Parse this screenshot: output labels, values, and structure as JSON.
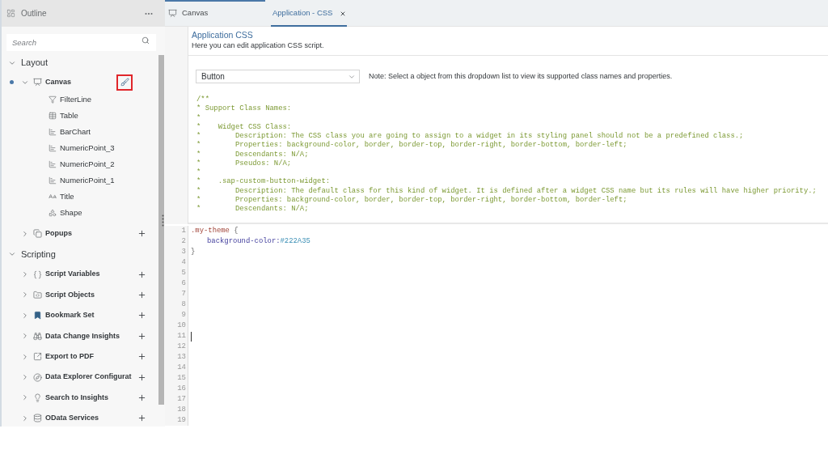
{
  "outline": {
    "title": "Outline",
    "search": {
      "placeholder": "Search"
    },
    "sections": [
      {
        "label": "Layout",
        "expanded": true,
        "children": [
          {
            "label": "Canvas",
            "kind": "canvas",
            "expanded": true,
            "active": true,
            "action": {
              "kind": "style",
              "annotated": true
            },
            "children": [
              {
                "label": "FilterLine",
                "kind": "filter"
              },
              {
                "label": "Table",
                "kind": "table"
              },
              {
                "label": "BarChart",
                "kind": "chart"
              },
              {
                "label": "NumericPoint_3",
                "kind": "chart"
              },
              {
                "label": "NumericPoint_2",
                "kind": "chart"
              },
              {
                "label": "NumericPoint_1",
                "kind": "chart"
              },
              {
                "label": "Title",
                "kind": "text"
              },
              {
                "label": "Shape",
                "kind": "shape"
              }
            ]
          },
          {
            "label": "Popups",
            "kind": "popup",
            "expanded": false,
            "active": false,
            "action": {
              "kind": "add",
              "annotated": false
            }
          }
        ]
      },
      {
        "label": "Scripting",
        "expanded": true,
        "children": [
          {
            "label": "Script Variables",
            "kind": "variable",
            "expanded": false,
            "action": {
              "kind": "add"
            }
          },
          {
            "label": "Script Objects",
            "kind": "object",
            "expanded": false,
            "action": {
              "kind": "add"
            }
          },
          {
            "label": "Bookmark Set",
            "kind": "bookmark",
            "expanded": false,
            "action": {
              "kind": "add"
            }
          },
          {
            "label": "Data Change Insights",
            "kind": "insight",
            "expanded": false,
            "action": {
              "kind": "add"
            }
          },
          {
            "label": "Export to PDF",
            "kind": "export",
            "expanded": false,
            "action": {
              "kind": "add"
            }
          },
          {
            "label": "Data Explorer Configurat",
            "kind": "explorer",
            "expanded": false,
            "action": {
              "kind": "add"
            }
          },
          {
            "label": "Search to Insights",
            "kind": "search",
            "expanded": false,
            "action": {
              "kind": "add"
            }
          },
          {
            "label": "OData Services",
            "kind": "odata",
            "expanded": false,
            "action": {
              "kind": "add"
            }
          }
        ]
      }
    ]
  },
  "tabs": [
    {
      "label": "Canvas",
      "kind": "canvas",
      "selected": false
    },
    {
      "label": "Application - CSS",
      "kind": "script",
      "selected": true
    }
  ],
  "editor": {
    "title": "Application CSS",
    "description": "Here you can edit application CSS script.",
    "dropdown": {
      "value": "Button"
    },
    "note": "Note: Select a object from this dropdown list to view its supported class names and properties.",
    "comment_lines": [
      "/**",
      "* Support Class Names:",
      "*",
      "*    Widget CSS Class:",
      "*        Description: The CSS class you are going to assign to a widget in its styling panel should not be a predefined class.;",
      "*        Properties: background-color, border, border-top, border-right, border-bottom, border-left;",
      "*        Descendants: N/A;",
      "*        Pseudos: N/A;",
      "*",
      "*    .sap-custom-button-widget:",
      "*        Description: The default class for this kind of widget. It is defined after a widget CSS name but its rules will have higher priority.;",
      "*        Properties: background-color, border, border-top, border-right, border-bottom, border-left;",
      "*        Descendants: N/A;"
    ],
    "code_lines": [
      {
        "number": "1",
        "cursor": false,
        "tokens": [
          {
            "text": ".my-theme",
            "kind": "selector"
          },
          {
            "text": " {",
            "kind": "punct"
          }
        ],
        "children": [
          {
            "number": "2",
            "cursor": false,
            "tokens": [
              {
                "text": "background-color:",
                "kind": "property"
              },
              {
                "text": "#222A35",
                "kind": "value"
              }
            ]
          }
        ]
      },
      {
        "number": "3",
        "cursor": false,
        "tokens": [
          {
            "text": "}",
            "kind": "punct"
          }
        ]
      },
      {
        "number": "4",
        "cursor": false
      },
      {
        "number": "5",
        "cursor": false
      },
      {
        "number": "6",
        "cursor": false
      },
      {
        "number": "7",
        "cursor": false
      },
      {
        "number": "8",
        "cursor": false
      },
      {
        "number": "9",
        "cursor": false
      },
      {
        "number": "10",
        "cursor": false
      },
      {
        "number": "11",
        "cursor": true
      },
      {
        "number": "12",
        "cursor": false
      },
      {
        "number": "13",
        "cursor": false
      },
      {
        "number": "14",
        "cursor": false
      },
      {
        "number": "15",
        "cursor": false
      },
      {
        "number": "16",
        "cursor": false
      },
      {
        "number": "17",
        "cursor": false
      },
      {
        "number": "18",
        "cursor": false
      },
      {
        "number": "19",
        "cursor": false
      }
    ]
  }
}
